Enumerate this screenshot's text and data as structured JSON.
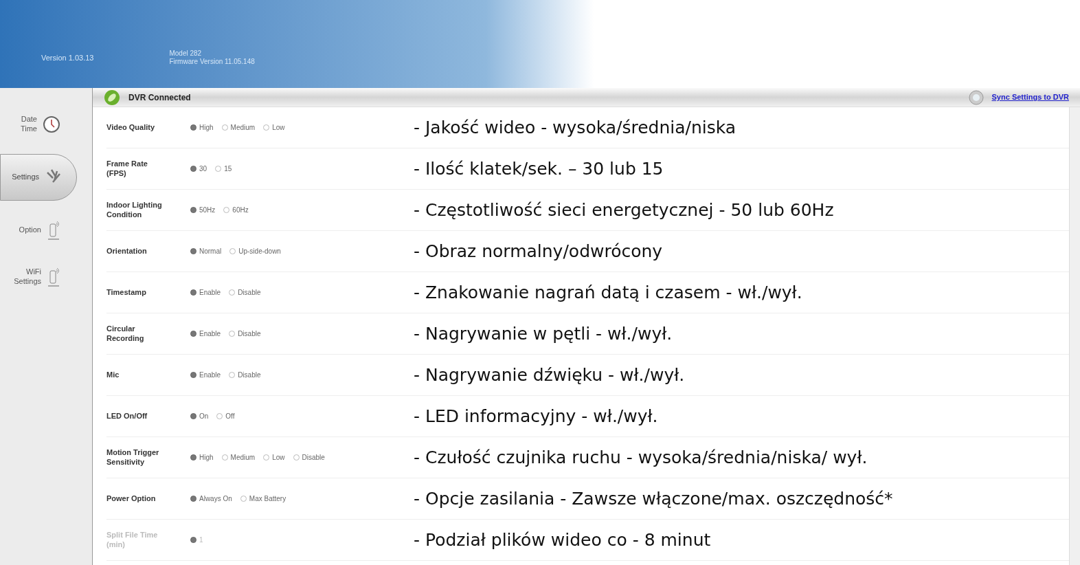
{
  "header": {
    "version": "Version 1.03.13",
    "model": "Model 282",
    "firmware": "Firmware Version 11.05.148"
  },
  "sidebar": {
    "items": [
      {
        "label": "Date\nTime",
        "kind": "clock",
        "selected": false
      },
      {
        "label": "Settings",
        "kind": "tools",
        "selected": true
      },
      {
        "label": "Option",
        "kind": "device",
        "selected": false
      },
      {
        "label": "WiFi\nSettings",
        "kind": "device",
        "selected": false
      }
    ]
  },
  "status": {
    "text": "DVR Connected",
    "connected": true,
    "sync_link": "Sync Settings to DVR"
  },
  "settings": [
    {
      "label": "Video Quality",
      "disabled": false,
      "options": [
        {
          "label": "High",
          "selected": true
        },
        {
          "label": "Medium",
          "selected": false
        },
        {
          "label": "Low",
          "selected": false
        }
      ],
      "note": "- Jakość wideo - wysoka/średnia/niska"
    },
    {
      "label": "Frame Rate\n(FPS)",
      "disabled": false,
      "options": [
        {
          "label": "30",
          "selected": true
        },
        {
          "label": "15",
          "selected": false
        }
      ],
      "note": "- Ilość klatek/sek. – 30 lub 15"
    },
    {
      "label": "Indoor Lighting\nCondition",
      "disabled": false,
      "options": [
        {
          "label": "50Hz",
          "selected": true
        },
        {
          "label": "60Hz",
          "selected": false
        }
      ],
      "note": "- Częstotliwość sieci energetycznej - 50 lub 60Hz"
    },
    {
      "label": "Orientation",
      "disabled": false,
      "options": [
        {
          "label": "Normal",
          "selected": true
        },
        {
          "label": "Up-side-down",
          "selected": false
        }
      ],
      "note": "- Obraz normalny/odwrócony"
    },
    {
      "label": "Timestamp",
      "disabled": false,
      "options": [
        {
          "label": "Enable",
          "selected": true
        },
        {
          "label": "Disable",
          "selected": false
        }
      ],
      "note": "- Znakowanie nagrań datą i czasem - wł./wył."
    },
    {
      "label": "Circular\nRecording",
      "disabled": false,
      "options": [
        {
          "label": "Enable",
          "selected": true
        },
        {
          "label": "Disable",
          "selected": false
        }
      ],
      "note": "- Nagrywanie w pętli - wł./wył."
    },
    {
      "label": "Mic",
      "disabled": false,
      "options": [
        {
          "label": "Enable",
          "selected": true
        },
        {
          "label": "Disable",
          "selected": false
        }
      ],
      "note": "- Nagrywanie dźwięku - wł./wył."
    },
    {
      "label": "LED On/Off",
      "disabled": false,
      "options": [
        {
          "label": "On",
          "selected": true
        },
        {
          "label": "Off",
          "selected": false
        }
      ],
      "note": "- LED informacyjny - wł./wył."
    },
    {
      "label": "Motion Trigger\nSensitivity",
      "disabled": false,
      "options": [
        {
          "label": "High",
          "selected": true
        },
        {
          "label": "Medium",
          "selected": false
        },
        {
          "label": "Low",
          "selected": false
        },
        {
          "label": "Disable",
          "selected": false
        }
      ],
      "note": "- Czułość czujnika ruchu - wysoka/średnia/niska/ wył."
    },
    {
      "label": "Power Option",
      "disabled": false,
      "options": [
        {
          "label": "Always On",
          "selected": true
        },
        {
          "label": "Max Battery",
          "selected": false
        }
      ],
      "note": "- Opcje zasilania - Zawsze włączone/max. oszczędność*"
    },
    {
      "label": "Split File Time\n(min)",
      "disabled": true,
      "options": [
        {
          "label": "1",
          "selected": true
        }
      ],
      "note": "- Podział plików wideo co - 8 minut"
    }
  ]
}
